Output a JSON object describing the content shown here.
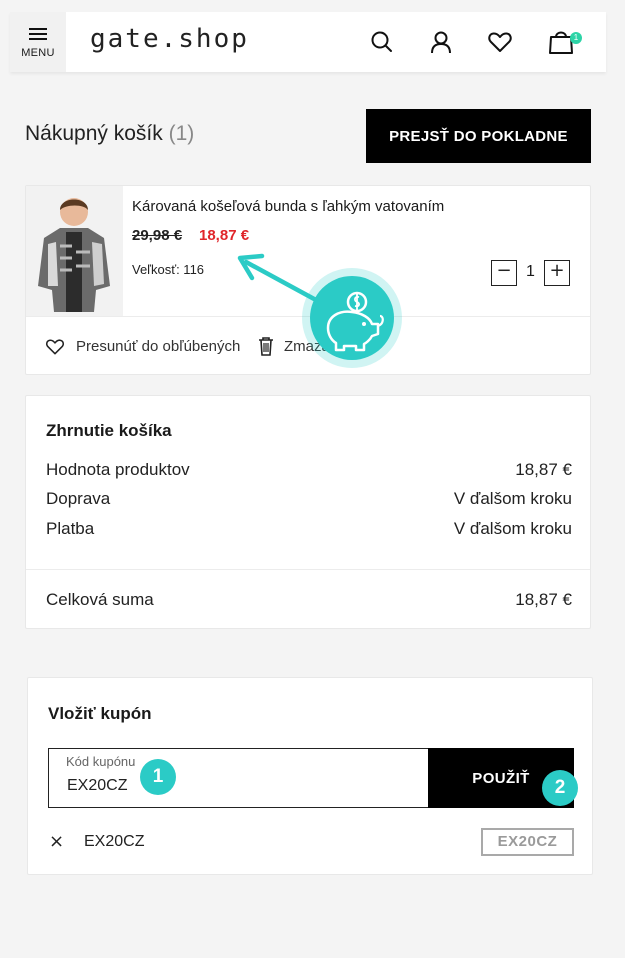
{
  "header": {
    "menu_label": "MENU",
    "logo": "gate.shop",
    "cart_count": "1",
    "icons": [
      "menu-icon",
      "search-icon",
      "user-icon",
      "heart-icon",
      "cart-icon"
    ]
  },
  "cart": {
    "title": "Nákupný košík",
    "count": "(1)",
    "checkout_label": "PREJSŤ DO POKLADNE"
  },
  "product": {
    "name": "Károvaná košeľová bunda s ľahkým vatovaním",
    "old_price": "29,98 €",
    "new_price": "18,87 €",
    "size": "Veľkosť: 116",
    "quantity": "1",
    "qty_minus": "−",
    "qty_plus": "+",
    "move_to_favorites": "Presunúť do obľúbených",
    "remove": "Zmazať"
  },
  "summary": {
    "title": "Zhrnutie košíka",
    "rows": [
      {
        "label": "Hodnota produktov",
        "value": "18,87 €"
      },
      {
        "label": "Doprava",
        "value": "V ďalšom kroku"
      },
      {
        "label": "Platba",
        "value": "V ďalšom kroku"
      }
    ],
    "total_label": "Celková suma",
    "total_value": "18,87 €"
  },
  "coupon": {
    "title": "Vložiť kupón",
    "field_label": "Kód kupónu",
    "field_value": "EX20CZ",
    "apply_label": "POUŽIŤ",
    "applied_code": "EX20CZ",
    "applied_badge": "EX20CZ",
    "remove_symbol": "×"
  },
  "annotations": {
    "marker_1": "1",
    "marker_2": "2",
    "accent_color": "#2bcbc6"
  },
  "colors": {
    "sale_price": "#e0262b",
    "button_bg": "#000000",
    "badge_green": "#2dd4a7"
  }
}
